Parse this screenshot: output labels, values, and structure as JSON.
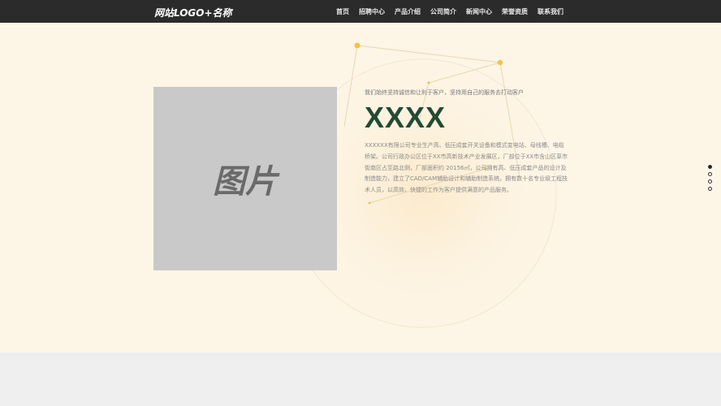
{
  "header": {
    "logo": "网站LOGO+名称",
    "nav": [
      "首页",
      "招聘中心",
      "产品介绍",
      "公司简介",
      "新闻中心",
      "荣誉资质",
      "联系我们"
    ]
  },
  "hero": {
    "image_label": "图片",
    "tagline": "我们始终坚持诚信和让利于客户，坚持用自己的服务去打动客户",
    "title": "XXXX",
    "body": "XXXXXX有限公司专业生产高、低压成套开关设备和模式变电站、母线槽、电缆桥架。公司行政办公区位于XX市高新技术产业发展区，厂部位于XX市含山区草市街南区占至路北侧，厂部面积约 20156㎡，公司拥有高、低压成套产品的设计及制造能力，建立了CAD/CAM辅助设计和辅助制造系统。拥有数十名专业级工程技术人员，以高效、快捷的工作为客户提供满意的产品服务。",
    "accent_color": "#f5c242"
  },
  "pager": {
    "count": 4,
    "active": 0
  }
}
